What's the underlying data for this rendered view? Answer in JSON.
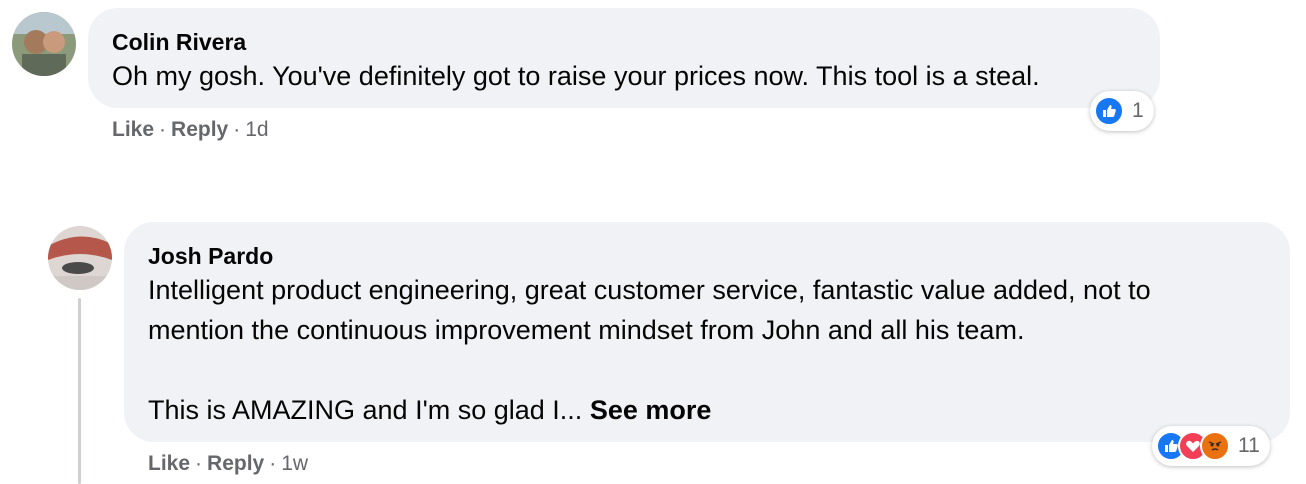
{
  "comments": [
    {
      "author": "Colin Rivera",
      "text_lines": [
        "Oh my gosh. You've definitely got to raise your prices now. This tool is a steal."
      ],
      "actions": {
        "like": "Like",
        "reply": "Reply",
        "time": "1d"
      },
      "reactions": {
        "icons": [
          "like-icon"
        ],
        "count": "1"
      }
    },
    {
      "author": "Josh Pardo",
      "text_lines": [
        "Intelligent product engineering, great customer service, fantastic value added, not to",
        "mention the continuous improvement mindset from John and all his team.",
        "This is AMAZING and I'm so glad I..."
      ],
      "see_more": "See more",
      "actions": {
        "like": "Like",
        "reply": "Reply",
        "time": "1w"
      },
      "reactions": {
        "icons": [
          "like-icon",
          "love-icon",
          "angry-icon"
        ],
        "count": "11"
      }
    }
  ],
  "separator": "·",
  "colors": {
    "bubble": "#f0f2f5",
    "like_blue": "#1877f2",
    "love_red": "#f33e58",
    "angry_orange": "#e9710f",
    "meta_gray": "#65676b"
  }
}
